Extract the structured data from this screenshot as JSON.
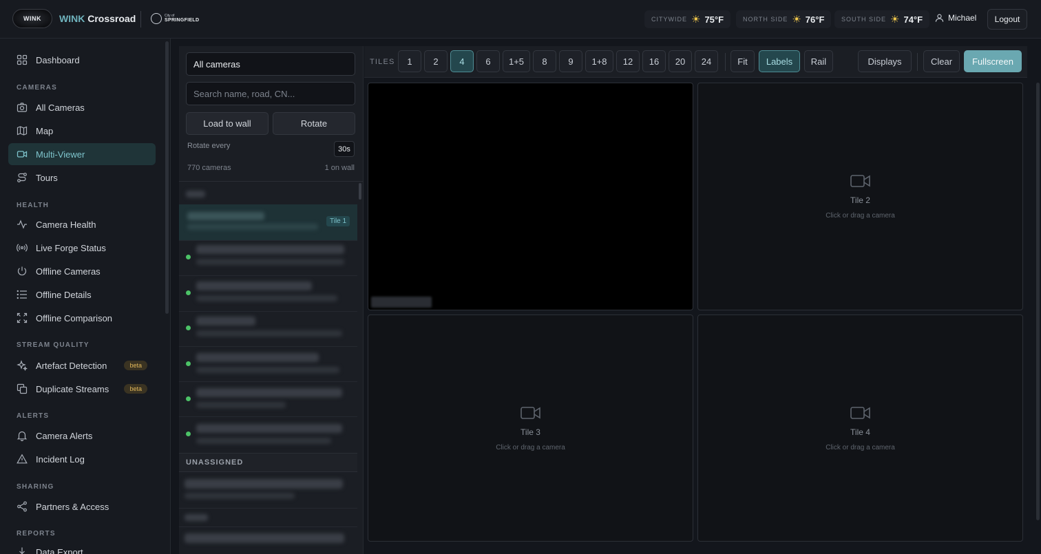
{
  "header": {
    "logo_text": "WINK",
    "brand_accent": "WINK",
    "brand_name": "Crossroad",
    "city_small": "City of",
    "city_name": "SPRINGFIELD",
    "weather": [
      {
        "label": "CITYWIDE",
        "temp": "75°F"
      },
      {
        "label": "NORTH SIDE",
        "temp": "76°F"
      },
      {
        "label": "SOUTH SIDE",
        "temp": "74°F"
      }
    ],
    "user_name": "Michael",
    "logout_label": "Logout"
  },
  "sidebar": {
    "dashboard": "Dashboard",
    "sections": {
      "cameras": "CAMERAS",
      "health": "HEALTH",
      "stream_quality": "STREAM QUALITY",
      "alerts": "ALERTS",
      "sharing": "SHARING",
      "reports": "REPORTS"
    },
    "items": {
      "all_cameras": "All Cameras",
      "map": "Map",
      "multi_viewer": "Multi-Viewer",
      "tours": "Tours",
      "camera_health": "Camera Health",
      "live_forge_status": "Live Forge Status",
      "offline_cameras": "Offline Cameras",
      "offline_details": "Offline Details",
      "offline_comparison": "Offline Comparison",
      "artefact_detection": "Artefact Detection",
      "duplicate_streams": "Duplicate Streams",
      "camera_alerts": "Camera Alerts",
      "incident_log": "Incident Log",
      "partners_access": "Partners & Access",
      "data_export": "Data Export"
    },
    "beta_label": "beta"
  },
  "camera_panel": {
    "filter_value": "All cameras",
    "search_placeholder": "Search name, road, CN...",
    "load_to_wall": "Load to wall",
    "rotate": "Rotate",
    "rotate_every_label": "Rotate every",
    "rotate_every_value": "30s",
    "camera_count": "770 cameras",
    "on_wall": "1 on wall",
    "tile_badge": "Tile 1",
    "unassigned_label": "UNASSIGNED"
  },
  "toolbar": {
    "tiles_label": "TILES",
    "tile_options": [
      "1",
      "2",
      "4",
      "6",
      "1+5",
      "8",
      "9",
      "1+8",
      "12",
      "16",
      "20",
      "24"
    ],
    "selected_tiles": "4",
    "fit": "Fit",
    "labels": "Labels",
    "rail": "Rail",
    "displays": "Displays",
    "clear": "Clear",
    "fullscreen": "Fullscreen"
  },
  "tiles": [
    {
      "title": "Tile 2",
      "hint": "Click or drag a camera"
    },
    {
      "title": "Tile 3",
      "hint": "Click or drag a camera"
    },
    {
      "title": "Tile 4",
      "hint": "Click or drag a camera"
    }
  ],
  "colors": {
    "accent": "#6aa8b1",
    "active_nav_bg": "#1f3438",
    "online_dot": "#4cc267",
    "beta_text": "#e0b75a"
  }
}
